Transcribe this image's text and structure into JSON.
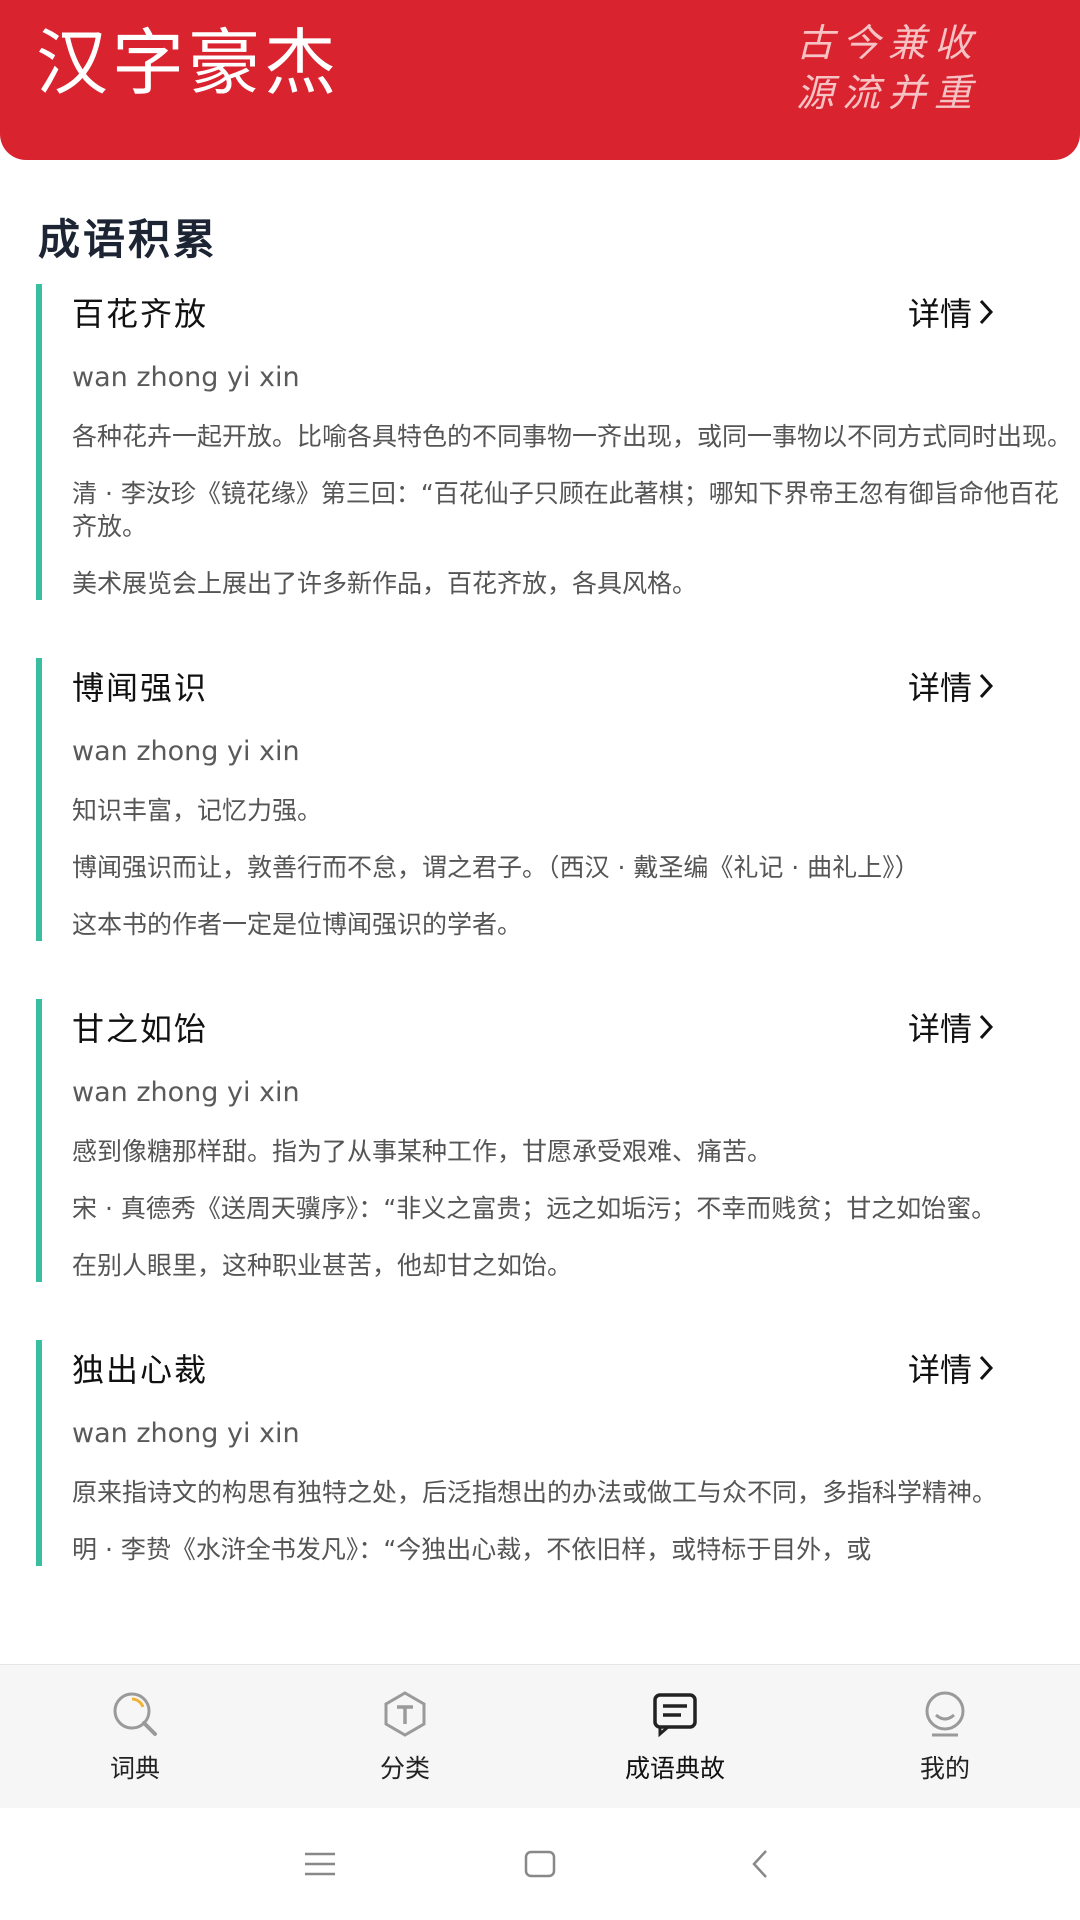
{
  "header": {
    "app_title": "汉字豪杰",
    "slogan_line1": "古今兼收",
    "slogan_line2": "源流并重"
  },
  "section": {
    "title": "成语积累"
  },
  "idioms": [
    {
      "name": "百花齐放",
      "detail_label": "详情",
      "pinyin": "wan zhong yi xin",
      "meaning": "各种花卉一起开放。比喻各具特色的不同事物一齐出现，或同一事物以不同方式同时出现。",
      "source": "清 · 李汝珍《镜花缘》第三回：“百花仙子只顾在此著棋；哪知下界帝王忽有御旨命他百花齐放。",
      "example": "美术展览会上展出了许多新作品，百花齐放，各具风格。"
    },
    {
      "name": "博闻强识",
      "detail_label": "详情",
      "pinyin": "wan zhong yi xin",
      "meaning": "知识丰富，记忆力强。",
      "source": "博闻强识而让，敦善行而不怠，谓之君子。（西汉 · 戴圣编《礼记 · 曲礼上》）",
      "example": "这本书的作者一定是位博闻强识的学者。"
    },
    {
      "name": "甘之如饴",
      "detail_label": "详情",
      "pinyin": "wan zhong yi xin",
      "meaning": "感到像糖那样甜。指为了从事某种工作，甘愿承受艰难、痛苦。",
      "source": "宋 · 真德秀《送周天骥序》：“非义之富贵；远之如垢污；不幸而贱贫；甘之如饴蜜。",
      "example": "在别人眼里，这种职业甚苦，他却甘之如饴。"
    },
    {
      "name": "独出心裁",
      "detail_label": "详情",
      "pinyin": "wan zhong yi xin",
      "meaning": "原来指诗文的构思有独特之处，后泛指想出的办法或做工与众不同，多指科学精神。",
      "source": "明 · 李贽《水浒全书发凡》：“今独出心裁，不依旧样，或特标于目外，或",
      "example": ""
    }
  ],
  "tabbar": {
    "tabs": [
      {
        "label": "词典",
        "icon": "dictionary-search-icon"
      },
      {
        "label": "分类",
        "icon": "category-icon"
      },
      {
        "label": "成语典故",
        "icon": "idiom-story-icon",
        "active": true
      },
      {
        "label": "我的",
        "icon": "profile-icon"
      }
    ],
    "accent_color": "#d9232f"
  },
  "colors": {
    "header_bg": "#d9232f",
    "accent_bar": "#39bfa0"
  }
}
